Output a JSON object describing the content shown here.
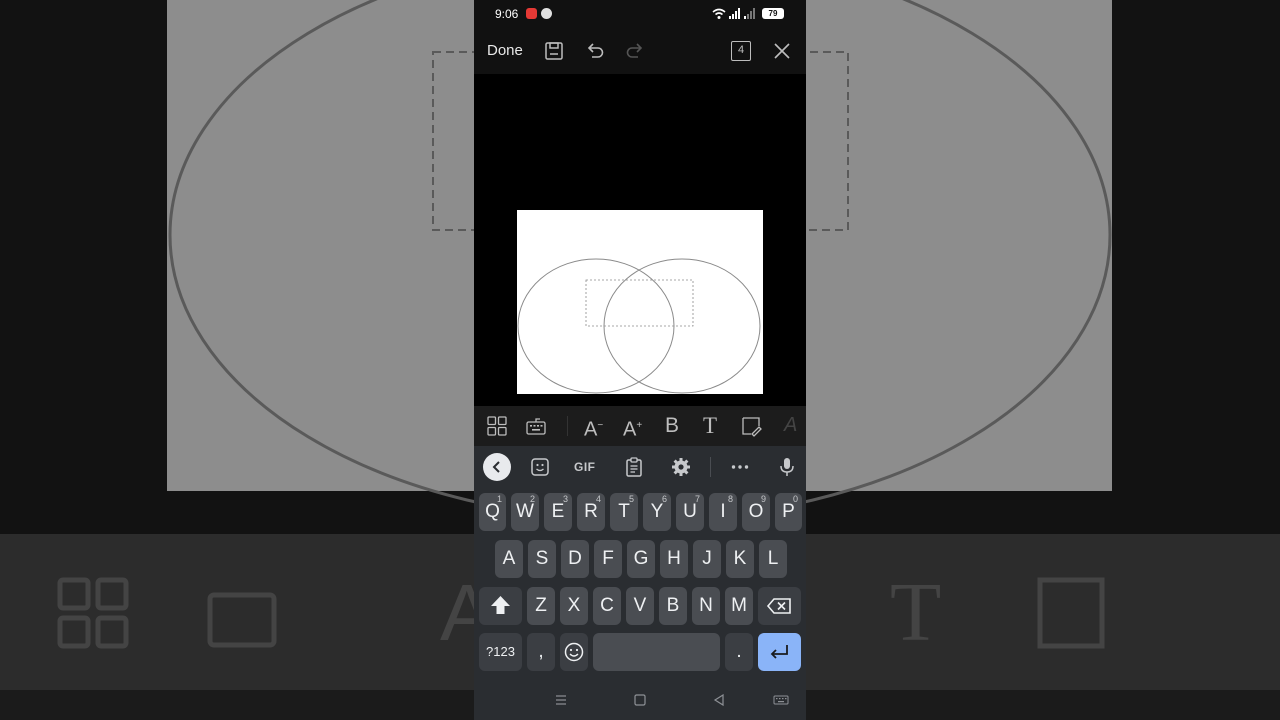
{
  "status_bar": {
    "time": "9:06",
    "battery": "79"
  },
  "top_bar": {
    "done_label": "Done",
    "page_count": "4"
  },
  "slide": {
    "shapes": "venn-two-circles-with-text-box"
  },
  "format_bar": {
    "icons": [
      "layout-icon",
      "keyboard-icon",
      "font-size-decrease-icon",
      "font-size-increase-icon",
      "bold-icon",
      "font-icon",
      "highlight-icon"
    ],
    "bold_label": "B",
    "font_label": "T",
    "font_decrease_label": "A",
    "font_increase_label": "A"
  },
  "keyboard": {
    "suggestion_gif": "GIF",
    "row1": [
      {
        "label": "Q",
        "hint": "1"
      },
      {
        "label": "W",
        "hint": "2"
      },
      {
        "label": "E",
        "hint": "3"
      },
      {
        "label": "R",
        "hint": "4"
      },
      {
        "label": "T",
        "hint": "5"
      },
      {
        "label": "Y",
        "hint": "6"
      },
      {
        "label": "U",
        "hint": "7"
      },
      {
        "label": "I",
        "hint": "8"
      },
      {
        "label": "O",
        "hint": "9"
      },
      {
        "label": "P",
        "hint": "0"
      }
    ],
    "row2": [
      "A",
      "S",
      "D",
      "F",
      "G",
      "H",
      "J",
      "K",
      "L"
    ],
    "row3": [
      "Z",
      "X",
      "C",
      "V",
      "B",
      "N",
      "M"
    ],
    "symbols_label": "?123",
    "comma_label": ",",
    "period_label": "."
  },
  "colors": {
    "accent": "#8ab4f8",
    "key": "#4a4d52",
    "keyboard_bg": "#2a2d31",
    "notif_red": "#e53935"
  }
}
